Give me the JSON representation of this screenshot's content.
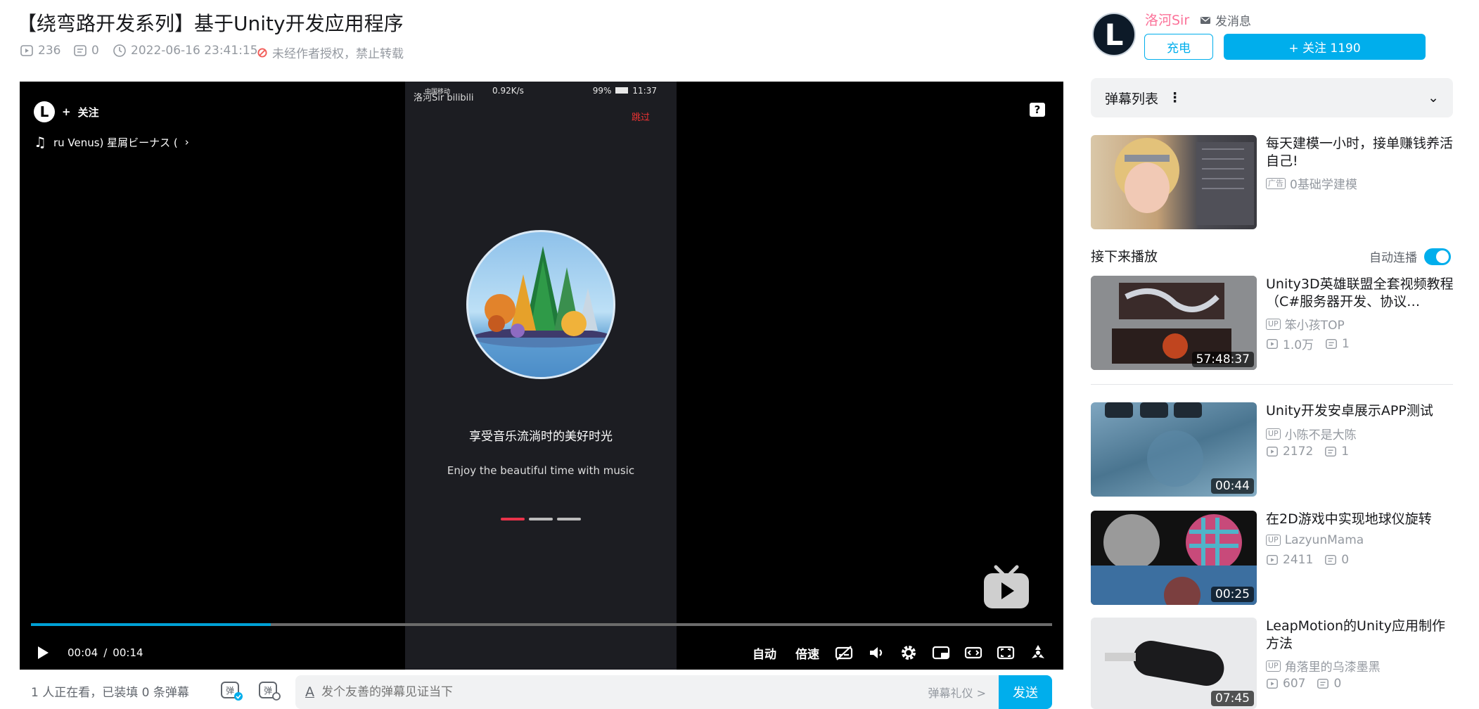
{
  "video": {
    "title": "【绕弯路开发系列】基于Unity开发应用程序",
    "views": "236",
    "danmaku_count": "0",
    "datetime": "2022-06-16 23:41:15",
    "copyright": "未经作者授权，禁止转载"
  },
  "player": {
    "follow_label": "关注",
    "avatar_letter": "L",
    "music_text": "ru Venus)  星屑ビーナス (",
    "help_label": "?",
    "status_bar": {
      "carrier": "中国移动",
      "speed": "0.92K/s",
      "battery": "99%",
      "clock": "11:37"
    },
    "phone_logo": "洛河Sir bilibili",
    "skip_label": "跳过",
    "phone_text_cn": "享受音乐流淌时的美好时光",
    "phone_text_en": "Enjoy the beautiful  time with music",
    "time_current": "00:04",
    "time_separator": "/",
    "time_total": "00:14",
    "progress": 0.235,
    "auto_label": "自动",
    "speed_label": "倍速",
    "accent": "#00a1d6"
  },
  "danmaku_bar": {
    "viewers_text": "1 人正在看，已装填 0 条弹幕",
    "input_placeholder": "发个友善的弹幕见证当下",
    "etiquette_label": "弹幕礼仪 >",
    "send_label": "发送"
  },
  "up": {
    "avatar_letter": "L",
    "name": "洛河Sir",
    "message_label": "发消息",
    "charge_label": "充电",
    "follow_label": "+ 关注 1190",
    "name_color": "#fb7299",
    "accent": "#00aeec"
  },
  "danmaku_list": {
    "label": "弹幕列表",
    "more": "⋮",
    "chevron": "⌄"
  },
  "ad": {
    "title": "每天建模一小时，接单赚钱养活自己!",
    "tag": "广告",
    "uploader": "0基础学建模"
  },
  "next": {
    "label": "接下来播放",
    "autoplay_label": "自动连播",
    "autoplay_on": true
  },
  "recommendations": [
    {
      "title": "Unity3D英雄联盟全套视频教程（C#服务器开发、协议…",
      "uploader": "笨小孩TOP",
      "views": "1.0万",
      "comments": "1",
      "duration": "57:48:37"
    },
    {
      "title": "Unity开发安卓展示APP测试",
      "uploader": "小陈不是大陈",
      "views": "2172",
      "comments": "1",
      "duration": "00:44"
    },
    {
      "title": "在2D游戏中实现地球仪旋转",
      "uploader": "LazyunMama",
      "views": "2411",
      "comments": "0",
      "duration": "00:25"
    },
    {
      "title": "LeapMotion的Unity应用制作方法",
      "uploader": "角落里的乌漆墨黑",
      "views": "607",
      "comments": "0",
      "duration": "07:45"
    }
  ],
  "up_tag": "UP"
}
